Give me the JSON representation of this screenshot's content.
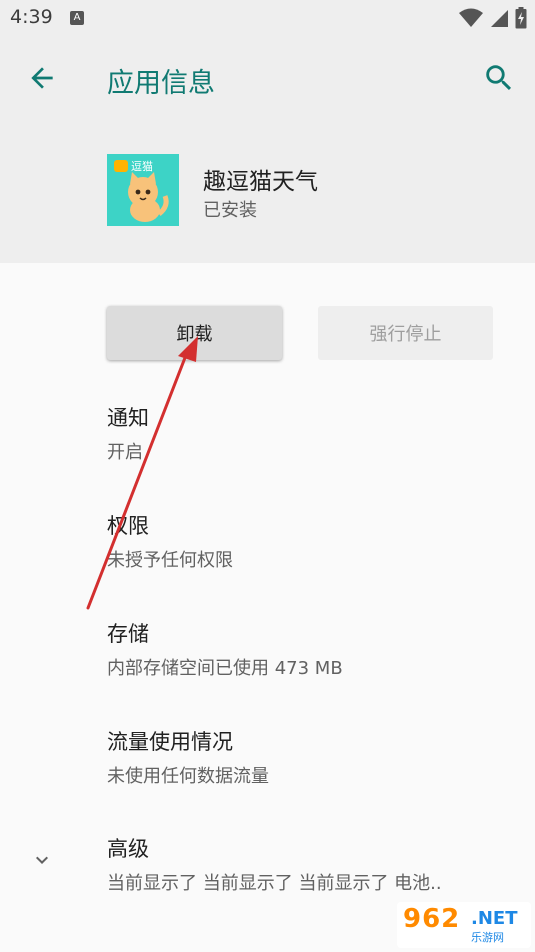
{
  "status_bar": {
    "time": "4:39",
    "notification_letter": "A"
  },
  "header": {
    "title": "应用信息"
  },
  "app": {
    "name": "趣逗猫天气",
    "status": "已安装",
    "icon_label": "逗猫"
  },
  "buttons": {
    "uninstall": "卸载",
    "force_stop": "强行停止"
  },
  "settings": [
    {
      "title": "通知",
      "summary": "开启"
    },
    {
      "title": "权限",
      "summary": "未授予任何权限"
    },
    {
      "title": "存储",
      "summary": "内部存储空间已使用 473 MB"
    },
    {
      "title": "流量使用情况",
      "summary": "未使用任何数据流量"
    },
    {
      "title": "高级",
      "summary": "当前显示了 当前显示了 当前显示了 电池.."
    }
  ],
  "watermark": {
    "number": "962",
    "suffix": ".NET",
    "sub": "乐游网"
  },
  "colors": {
    "accent": "#107a72",
    "arrow": "#d32f2f",
    "header_bg": "#eeeeee"
  }
}
